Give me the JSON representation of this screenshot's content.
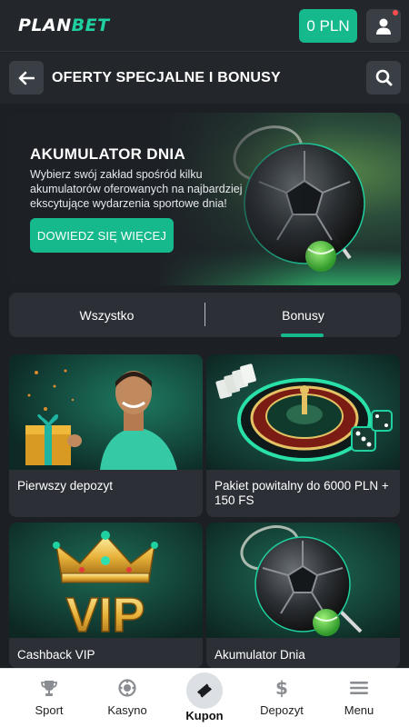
{
  "header": {
    "logo_plan": "PLAN",
    "logo_bet": "BET",
    "balance": "0 PLN",
    "user_icon": "user-icon"
  },
  "pagebar": {
    "title": "OFERTY SPECJALNE I BONUSY",
    "back_icon": "arrow-left-icon",
    "search_icon": "search-icon"
  },
  "hero": {
    "title": "AKUMULATOR DNIA",
    "description": "Wybierz swój zakład spośród kilku akumulatorów oferowanych na najbardziej ekscytujące wydarzenia sportowe dnia!",
    "button": "DOWIEDZ SIĘ WIĘCEJ"
  },
  "tabs": {
    "all": "Wszystko",
    "bonus": "Bonusy",
    "active": "bonus"
  },
  "cards": [
    {
      "label": "Pierwszy depozyt"
    },
    {
      "label": "Pakiet powitalny do 6000 PLN + 150 FS"
    },
    {
      "label": "Cashback VIP",
      "art_text": "VIP"
    },
    {
      "label": "Akumulator Dnia"
    }
  ],
  "bottom_nav": [
    {
      "label": "Sport",
      "icon": "trophy-icon"
    },
    {
      "label": "Kasyno",
      "icon": "casino-chip-icon"
    },
    {
      "label": "Kupon",
      "icon": "ticket-icon",
      "active": true
    },
    {
      "label": "Depozyt",
      "icon": "dollar-icon"
    },
    {
      "label": "Menu",
      "icon": "hamburger-menu-icon"
    }
  ],
  "colors": {
    "accent": "#16b98c",
    "background": "#1c1f24",
    "surface": "#2c3036",
    "nav_background": "#ffffff"
  }
}
